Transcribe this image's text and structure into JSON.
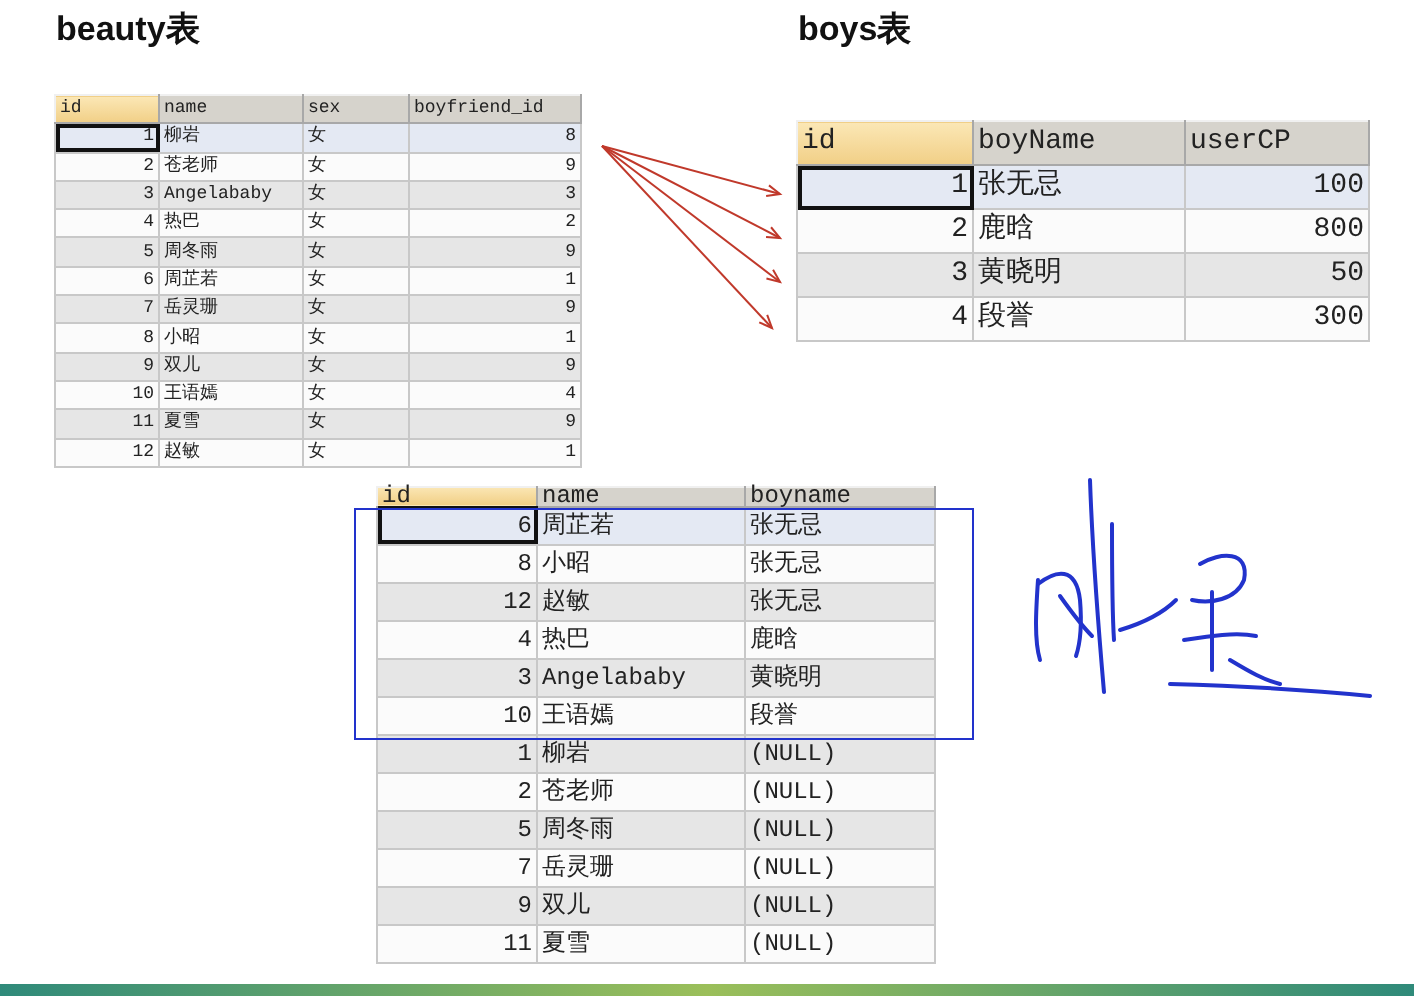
{
  "beauty": {
    "title": "beauty表",
    "columns": [
      "id",
      "name",
      "sex",
      "boyfriend_id"
    ],
    "rows": [
      {
        "cells": [
          "1",
          "柳岩",
          "女",
          "8"
        ],
        "selected": true
      },
      {
        "cells": [
          "2",
          "苍老师",
          "女",
          "9"
        ],
        "selected": false
      },
      {
        "cells": [
          "3",
          "Angelababy",
          "女",
          "3"
        ],
        "selected": false
      },
      {
        "cells": [
          "4",
          "热巴",
          "女",
          "2"
        ],
        "selected": false
      },
      {
        "cells": [
          "5",
          "周冬雨",
          "女",
          "9"
        ],
        "selected": false
      },
      {
        "cells": [
          "6",
          "周芷若",
          "女",
          "1"
        ],
        "selected": false
      },
      {
        "cells": [
          "7",
          "岳灵珊",
          "女",
          "9"
        ],
        "selected": false
      },
      {
        "cells": [
          "8",
          "小昭",
          "女",
          "1"
        ],
        "selected": false
      },
      {
        "cells": [
          "9",
          "双儿",
          "女",
          "9"
        ],
        "selected": false
      },
      {
        "cells": [
          "10",
          "王语嫣",
          "女",
          "4"
        ],
        "selected": false
      },
      {
        "cells": [
          "11",
          "夏雪",
          "女",
          "9"
        ],
        "selected": false
      },
      {
        "cells": [
          "12",
          "赵敏",
          "女",
          "1"
        ],
        "selected": false
      }
    ]
  },
  "boys": {
    "title": "boys表",
    "columns": [
      "id",
      "boyName",
      "userCP"
    ],
    "rows": [
      {
        "cells": [
          "1",
          "张无忌",
          "100"
        ],
        "selected": true
      },
      {
        "cells": [
          "2",
          "鹿晗",
          "800"
        ],
        "selected": false
      },
      {
        "cells": [
          "3",
          "黄晓明",
          "50"
        ],
        "selected": false
      },
      {
        "cells": [
          "4",
          "段誉",
          "300"
        ],
        "selected": false
      }
    ]
  },
  "result": {
    "columns": [
      "id",
      "name",
      "boyname"
    ],
    "rows": [
      {
        "cells": [
          "6",
          "周芷若",
          "张无忌"
        ],
        "selected": true
      },
      {
        "cells": [
          "8",
          "小昭",
          "张无忌"
        ],
        "selected": false
      },
      {
        "cells": [
          "12",
          "赵敏",
          "张无忌"
        ],
        "selected": false
      },
      {
        "cells": [
          "4",
          "热巴",
          "鹿晗"
        ],
        "selected": false
      },
      {
        "cells": [
          "3",
          "Angelababy",
          "黄晓明"
        ],
        "selected": false
      },
      {
        "cells": [
          "10",
          "王语嫣",
          "段誉"
        ],
        "selected": false
      },
      {
        "cells": [
          "1",
          "柳岩",
          "(NULL)"
        ],
        "selected": false
      },
      {
        "cells": [
          "2",
          "苍老师",
          "(NULL)"
        ],
        "selected": false
      },
      {
        "cells": [
          "5",
          "周冬雨",
          "(NULL)"
        ],
        "selected": false
      },
      {
        "cells": [
          "7",
          "岳灵珊",
          "(NULL)"
        ],
        "selected": false
      },
      {
        "cells": [
          "9",
          "双儿",
          "(NULL)"
        ],
        "selected": false
      },
      {
        "cells": [
          "11",
          "夏雪",
          "(NULL)"
        ],
        "selected": false
      }
    ]
  }
}
